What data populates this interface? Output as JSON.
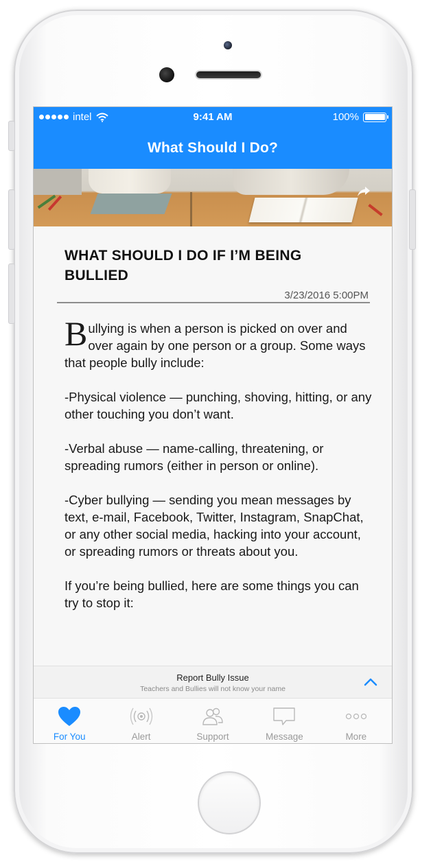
{
  "status_bar": {
    "carrier": "intel",
    "time": "9:41 AM",
    "battery": "100%"
  },
  "nav": {
    "title": "What Should I Do?"
  },
  "hero": {
    "icon": "share-icon"
  },
  "article": {
    "title": "WHAT SHOULD I DO IF I’M BEING BULLIED",
    "date": "3/23/2016 5:00PM",
    "dropcap": "B",
    "paragraphs": [
      "ullying is when a person is picked on over and over again by one person or a group. Some ways that people bully include:",
      "-Physical violence — punching, shoving, hitting, or any other touching you don’t want.",
      "-Verbal abuse — name-calling, threatening, or spreading rumors (either in person or online).",
      "-Cyber bullying — sending you mean messages by text, e-mail, Facebook, Twitter, Instagram, SnapChat, or any other social media, hacking into your account, or spreading rumors or threats about you.",
      "If you’re being bullied, here are some things you can try to stop it:"
    ]
  },
  "report": {
    "title": "Report Bully Issue",
    "subtitle": "Teachers and Bullies will not know your name",
    "toggle_icon": "chevron-up-icon"
  },
  "tabs": [
    {
      "label": "For You",
      "icon": "heart-icon",
      "active": true
    },
    {
      "label": "Alert",
      "icon": "alert-signal-icon",
      "active": false
    },
    {
      "label": "Support",
      "icon": "people-icon",
      "active": false
    },
    {
      "label": "Message",
      "icon": "message-bubble-icon",
      "active": false
    },
    {
      "label": "More",
      "icon": "more-dots-icon",
      "active": false
    }
  ],
  "colors": {
    "accent": "#1a8cff",
    "tab_inactive": "#9a9a9a"
  }
}
